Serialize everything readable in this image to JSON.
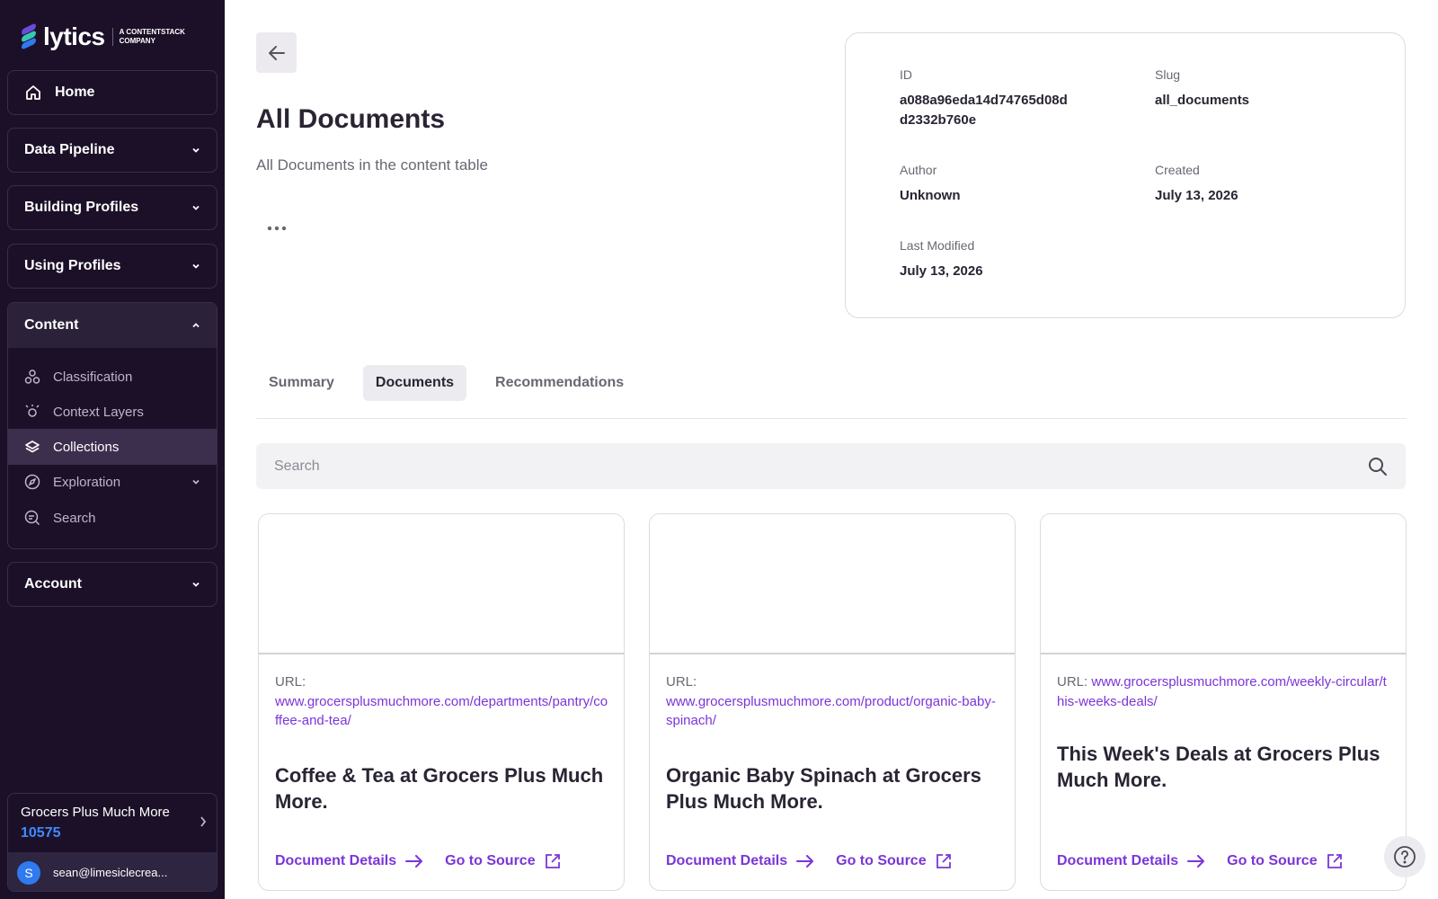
{
  "brand": {
    "logo_text": "lytics",
    "tagline_line1": "A CONTENTSTACK",
    "tagline_line2": "COMPANY"
  },
  "sidebar": {
    "home": "Home",
    "sections": [
      "Data Pipeline",
      "Building Profiles",
      "Using Profiles"
    ],
    "content": {
      "label": "Content",
      "items": [
        {
          "label": "Classification",
          "icon": "classification-icon"
        },
        {
          "label": "Context Layers",
          "icon": "context-layers-icon"
        },
        {
          "label": "Collections",
          "icon": "collections-icon",
          "active": true
        },
        {
          "label": "Exploration",
          "icon": "exploration-icon"
        },
        {
          "label": "Search",
          "icon": "search-icon"
        }
      ]
    },
    "account_label": "Account",
    "account": {
      "name": "Grocers Plus Much More",
      "id": "10575",
      "avatar_letter": "S",
      "email": "sean@limesiclecrea..."
    }
  },
  "page": {
    "title": "All Documents",
    "description": "All Documents in the content table"
  },
  "meta": {
    "id_label": "ID",
    "id_line1": "a088a96eda14d74765d08d",
    "id_line2": "d2332b760e",
    "slug_label": "Slug",
    "slug": "all_documents",
    "author_label": "Author",
    "author": "Unknown",
    "created_label": "Created",
    "created": "July 13, 2026",
    "modified_label": "Last Modified",
    "modified": "July 13, 2026"
  },
  "tabs": [
    {
      "label": "Summary",
      "active": false
    },
    {
      "label": "Documents",
      "active": true
    },
    {
      "label": "Recommendations",
      "active": false
    }
  ],
  "search": {
    "placeholder": "Search"
  },
  "documents": [
    {
      "url_label": "URL:",
      "url": "www.grocersplusmuchmore.com/departments/pantry/coffee-and-tea/",
      "title": "Coffee & Tea at Grocers Plus Much More.",
      "details_label": "Document Details",
      "source_label": "Go to Source"
    },
    {
      "url_label": "URL:",
      "url": "www.grocersplusmuchmore.com/product/organic-baby-spinach/",
      "title": "Organic Baby Spinach at Grocers Plus Much More.",
      "details_label": "Document Details",
      "source_label": "Go to Source"
    },
    {
      "url_label": "URL:",
      "url": "www.grocersplusmuchmore.com/weekly-circular/this-weeks-deals/",
      "title": "This Week's Deals at Grocers Plus Much More.",
      "details_label": "Document Details",
      "source_label": "Go to Source"
    }
  ],
  "colors": {
    "sidebar_bg": "#1c1028",
    "accent_purple": "#7b35d8",
    "account_id_blue": "#3d8bff"
  }
}
